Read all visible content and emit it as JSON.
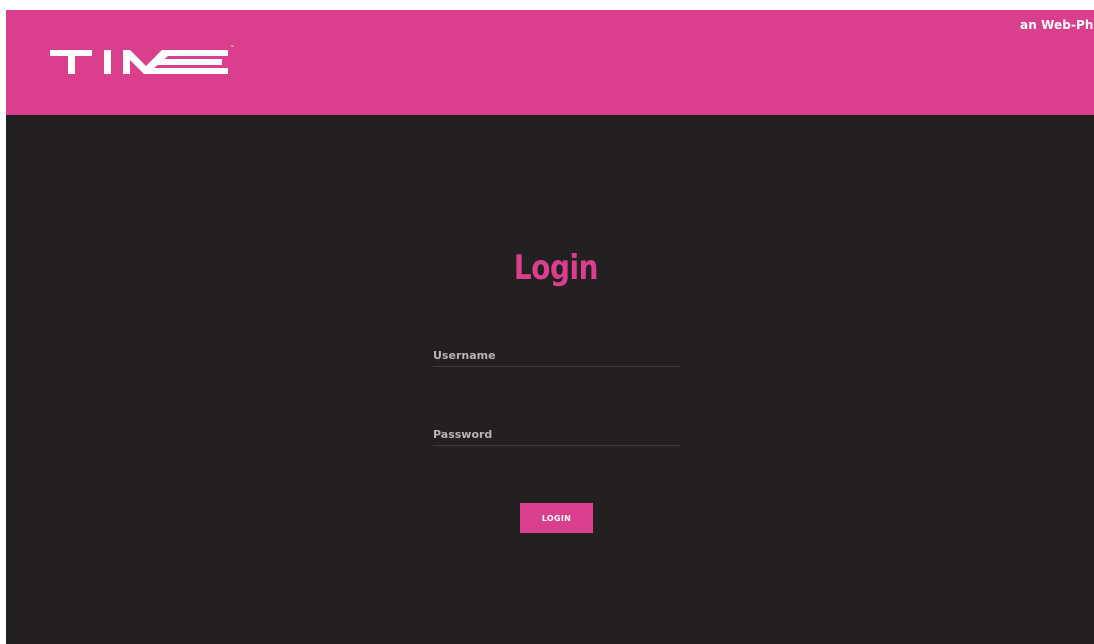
{
  "header": {
    "brand_logo": "TIME",
    "brand_trademark": "™",
    "tagline": "an Web-Phone"
  },
  "login": {
    "title": "Login",
    "username_placeholder": "Username",
    "username_value": "",
    "password_placeholder": "Password",
    "password_value": "",
    "button_label": "LOGIN"
  },
  "colors": {
    "accent": "#d93f8c",
    "background": "#222021",
    "text_on_accent": "#ffffff",
    "field_underline": "#3d3b3c"
  },
  "icons": {
    "logo": "time-logo"
  }
}
